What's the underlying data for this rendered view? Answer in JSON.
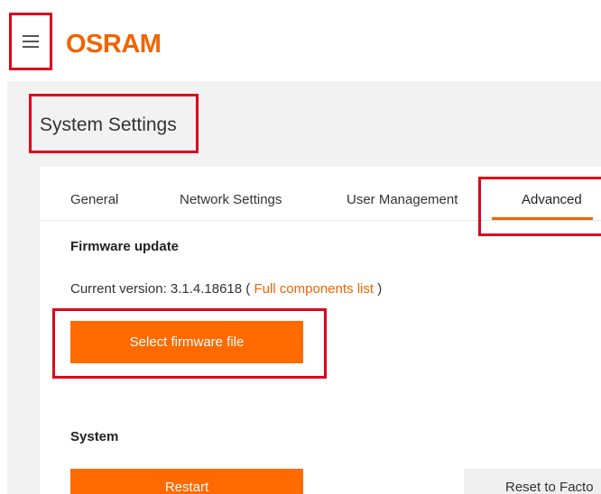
{
  "header": {
    "logo_text": "OSRAM",
    "brand_color": "#f06400",
    "menu_icon": "hamburger-menu-icon"
  },
  "page": {
    "title": "System Settings"
  },
  "tabs": [
    {
      "label": "General",
      "active": false
    },
    {
      "label": "Network Settings",
      "active": false
    },
    {
      "label": "User Management",
      "active": false
    },
    {
      "label": "Advanced",
      "active": true
    }
  ],
  "firmware": {
    "section_title": "Firmware update",
    "version_prefix": "Current version: ",
    "version": "3.1.4.18618",
    "open_paren": " ( ",
    "components_link": "Full components list",
    "close_paren": " )",
    "select_button": "Select firmware file"
  },
  "system": {
    "section_title": "System",
    "restart_button": "Restart",
    "reset_button": "Reset to Facto"
  },
  "colors": {
    "accent": "#f06400",
    "button": "#ff6a00",
    "highlight_box": "#e0001b"
  }
}
